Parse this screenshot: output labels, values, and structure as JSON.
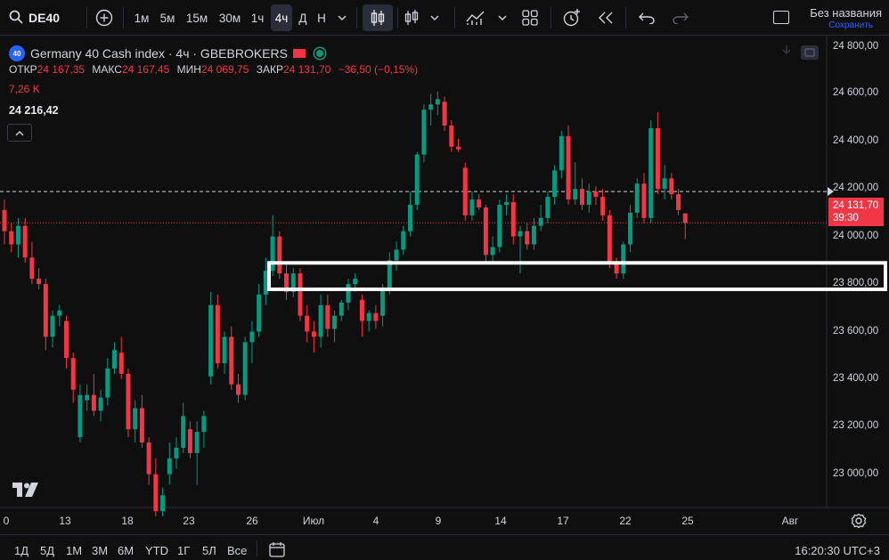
{
  "toolbar": {
    "symbol": "DE40",
    "timeframes": [
      "1м",
      "5м",
      "15м",
      "30м",
      "1ч",
      "4ч",
      "Д",
      "Н"
    ],
    "active_timeframe": "4ч",
    "icons": [
      "search-icon",
      "add-symbol-icon",
      "timeframe-dropdown-icon",
      "candles-icon",
      "indicators-icon",
      "chart-type-dropdown-icon",
      "compare-icon",
      "templates-icon",
      "alert-icon",
      "replay-icon",
      "undo-icon",
      "redo-icon",
      "layout-icon"
    ],
    "layout_name": "Без названия",
    "layout_status": "Сохранить"
  },
  "legend": {
    "badge": "40",
    "title": "Germany 40 Cash index · 4ч · GBEBROKERS",
    "open_label": "ОТКР",
    "open": "24 167,35",
    "high_label": "МАКС",
    "high": "24 167,45",
    "low_label": "МИН",
    "low": "24 069,75",
    "close_label": "ЗАКР",
    "close": "24 131,70",
    "change": "−36,50 (−0,15%)",
    "volume": "7,26 K",
    "crosshair_price": "24 216,42"
  },
  "price_axis": {
    "labels": [
      "24 800,00",
      "24 600,00",
      "24 400,00",
      "24 200,00",
      "24 000,00",
      "23 800,00",
      "23 600,00",
      "23 400,00",
      "23 200,00",
      "23 000,00"
    ],
    "last_price": "24 131,70",
    "countdown": "39:30"
  },
  "time_axis": {
    "labels": [
      "0",
      "13",
      "18",
      "23",
      "26",
      "Июл",
      "4",
      "9",
      "14",
      "17",
      "22",
      "25",
      "Авг"
    ]
  },
  "bottom": {
    "ranges": [
      "1Д",
      "5Д",
      "1М",
      "3М",
      "6М",
      "YTD",
      "1Г",
      "5Л",
      "Все"
    ],
    "clock": "16:20:30 UTC+3"
  },
  "colors": {
    "up": "#089981",
    "down": "#f23645",
    "background": "#0f0f0f",
    "highlight_box": "#ffffff"
  },
  "chart_data": {
    "type": "candlestick",
    "title": "Germany 40 Cash index · 4ч · GBEBROKERS",
    "ylim": [
      22950,
      24850
    ],
    "candles": [
      {
        "o": 24180,
        "h": 24220,
        "l": 24050,
        "c": 24100
      },
      {
        "o": 24100,
        "h": 24130,
        "l": 24020,
        "c": 24050
      },
      {
        "o": 24050,
        "h": 24150,
        "l": 24000,
        "c": 24120
      },
      {
        "o": 24120,
        "h": 24150,
        "l": 23980,
        "c": 24000
      },
      {
        "o": 24000,
        "h": 24060,
        "l": 23900,
        "c": 23920
      },
      {
        "o": 23920,
        "h": 23960,
        "l": 23880,
        "c": 23900
      },
      {
        "o": 23900,
        "h": 23920,
        "l": 23650,
        "c": 23700
      },
      {
        "o": 23700,
        "h": 23800,
        "l": 23660,
        "c": 23780
      },
      {
        "o": 23780,
        "h": 23820,
        "l": 23740,
        "c": 23800
      },
      {
        "o": 23760,
        "h": 23780,
        "l": 23580,
        "c": 23620
      },
      {
        "o": 23620,
        "h": 23640,
        "l": 23450,
        "c": 23500
      },
      {
        "o": 23320,
        "h": 23520,
        "l": 23300,
        "c": 23480
      },
      {
        "o": 23460,
        "h": 23520,
        "l": 23420,
        "c": 23480
      },
      {
        "o": 23480,
        "h": 23560,
        "l": 23400,
        "c": 23420
      },
      {
        "o": 23420,
        "h": 23500,
        "l": 23380,
        "c": 23470
      },
      {
        "o": 23470,
        "h": 23620,
        "l": 23440,
        "c": 23580
      },
      {
        "o": 23580,
        "h": 23680,
        "l": 23560,
        "c": 23650
      },
      {
        "o": 23640,
        "h": 23700,
        "l": 23540,
        "c": 23560
      },
      {
        "o": 23560,
        "h": 23580,
        "l": 23320,
        "c": 23350
      },
      {
        "o": 23350,
        "h": 23460,
        "l": 23300,
        "c": 23430
      },
      {
        "o": 23430,
        "h": 23480,
        "l": 23280,
        "c": 23300
      },
      {
        "o": 23300,
        "h": 23320,
        "l": 23140,
        "c": 23180
      },
      {
        "o": 23180,
        "h": 23240,
        "l": 23020,
        "c": 23040
      },
      {
        "o": 23040,
        "h": 23130,
        "l": 23020,
        "c": 23100
      },
      {
        "o": 23180,
        "h": 23300,
        "l": 23140,
        "c": 23240
      },
      {
        "o": 23240,
        "h": 23320,
        "l": 23200,
        "c": 23280
      },
      {
        "o": 23280,
        "h": 23450,
        "l": 23260,
        "c": 23400
      },
      {
        "o": 23350,
        "h": 23380,
        "l": 23240,
        "c": 23260
      },
      {
        "o": 23260,
        "h": 23380,
        "l": 23140,
        "c": 23340
      },
      {
        "o": 23340,
        "h": 23420,
        "l": 23280,
        "c": 23400
      },
      {
        "o": 23550,
        "h": 23870,
        "l": 23520,
        "c": 23820
      },
      {
        "o": 23820,
        "h": 23860,
        "l": 23580,
        "c": 23600
      },
      {
        "o": 23600,
        "h": 23720,
        "l": 23560,
        "c": 23700
      },
      {
        "o": 23700,
        "h": 23740,
        "l": 23500,
        "c": 23520
      },
      {
        "o": 23520,
        "h": 23560,
        "l": 23450,
        "c": 23480
      },
      {
        "o": 23480,
        "h": 23700,
        "l": 23460,
        "c": 23680
      },
      {
        "o": 23680,
        "h": 23760,
        "l": 23600,
        "c": 23720
      },
      {
        "o": 23720,
        "h": 23900,
        "l": 23700,
        "c": 23860
      },
      {
        "o": 23860,
        "h": 24000,
        "l": 23820,
        "c": 23950
      },
      {
        "o": 23950,
        "h": 24160,
        "l": 23930,
        "c": 24080
      },
      {
        "o": 24080,
        "h": 24100,
        "l": 23920,
        "c": 23940
      },
      {
        "o": 23940,
        "h": 23980,
        "l": 23840,
        "c": 23870
      },
      {
        "o": 23870,
        "h": 23960,
        "l": 23850,
        "c": 23940
      },
      {
        "o": 23940,
        "h": 23960,
        "l": 23760,
        "c": 23780
      },
      {
        "o": 23780,
        "h": 23820,
        "l": 23680,
        "c": 23720
      },
      {
        "o": 23720,
        "h": 23760,
        "l": 23640,
        "c": 23700
      },
      {
        "o": 23700,
        "h": 23860,
        "l": 23660,
        "c": 23820
      },
      {
        "o": 23820,
        "h": 23860,
        "l": 23700,
        "c": 23730
      },
      {
        "o": 23730,
        "h": 23800,
        "l": 23680,
        "c": 23780
      },
      {
        "o": 23780,
        "h": 23840,
        "l": 23760,
        "c": 23830
      },
      {
        "o": 23830,
        "h": 23920,
        "l": 23800,
        "c": 23900
      },
      {
        "o": 23900,
        "h": 23940,
        "l": 23870,
        "c": 23920
      },
      {
        "o": 23840,
        "h": 23860,
        "l": 23700,
        "c": 23760
      },
      {
        "o": 23760,
        "h": 23800,
        "l": 23720,
        "c": 23790
      },
      {
        "o": 23790,
        "h": 23820,
        "l": 23730,
        "c": 23760
      },
      {
        "o": 23780,
        "h": 23900,
        "l": 23740,
        "c": 23880
      },
      {
        "o": 23880,
        "h": 24020,
        "l": 23860,
        "c": 23990
      },
      {
        "o": 23990,
        "h": 24060,
        "l": 23950,
        "c": 24030
      },
      {
        "o": 24030,
        "h": 24120,
        "l": 24010,
        "c": 24100
      },
      {
        "o": 24100,
        "h": 24250,
        "l": 24080,
        "c": 24200
      },
      {
        "o": 24200,
        "h": 24400,
        "l": 24180,
        "c": 24390
      },
      {
        "o": 24390,
        "h": 24580,
        "l": 24360,
        "c": 24560
      },
      {
        "o": 24560,
        "h": 24620,
        "l": 24500,
        "c": 24580
      },
      {
        "o": 24580,
        "h": 24630,
        "l": 24540,
        "c": 24600
      },
      {
        "o": 24590,
        "h": 24610,
        "l": 24480,
        "c": 24500
      },
      {
        "o": 24500,
        "h": 24520,
        "l": 24400,
        "c": 24420
      },
      {
        "o": 24420,
        "h": 24450,
        "l": 24400,
        "c": 24410
      },
      {
        "o": 24340,
        "h": 24360,
        "l": 24140,
        "c": 24160
      },
      {
        "o": 24160,
        "h": 24250,
        "l": 24140,
        "c": 24220
      },
      {
        "o": 24220,
        "h": 24240,
        "l": 24180,
        "c": 24190
      },
      {
        "o": 24190,
        "h": 24200,
        "l": 23980,
        "c": 24010
      },
      {
        "o": 24010,
        "h": 24080,
        "l": 23980,
        "c": 24040
      },
      {
        "o": 24040,
        "h": 24220,
        "l": 24020,
        "c": 24200
      },
      {
        "o": 24200,
        "h": 24240,
        "l": 24160,
        "c": 24210
      },
      {
        "o": 24210,
        "h": 24240,
        "l": 24050,
        "c": 24080
      },
      {
        "o": 24080,
        "h": 24120,
        "l": 23940,
        "c": 24100
      },
      {
        "o": 24100,
        "h": 24130,
        "l": 24030,
        "c": 24050
      },
      {
        "o": 24050,
        "h": 24150,
        "l": 24030,
        "c": 24120
      },
      {
        "o": 24120,
        "h": 24200,
        "l": 24100,
        "c": 24150
      },
      {
        "o": 24150,
        "h": 24250,
        "l": 24130,
        "c": 24230
      },
      {
        "o": 24230,
        "h": 24350,
        "l": 24200,
        "c": 24330
      },
      {
        "o": 24330,
        "h": 24480,
        "l": 24300,
        "c": 24460
      },
      {
        "o": 24460,
        "h": 24500,
        "l": 24200,
        "c": 24220
      },
      {
        "o": 24220,
        "h": 24360,
        "l": 24200,
        "c": 24260
      },
      {
        "o": 24260,
        "h": 24300,
        "l": 24180,
        "c": 24200
      },
      {
        "o": 24200,
        "h": 24280,
        "l": 24170,
        "c": 24250
      },
      {
        "o": 24250,
        "h": 24270,
        "l": 24200,
        "c": 24230
      },
      {
        "o": 24230,
        "h": 24260,
        "l": 24140,
        "c": 24160
      },
      {
        "o": 24160,
        "h": 24180,
        "l": 23960,
        "c": 23980
      },
      {
        "o": 23980,
        "h": 24000,
        "l": 23920,
        "c": 23940
      },
      {
        "o": 23940,
        "h": 24060,
        "l": 23920,
        "c": 24050
      },
      {
        "o": 24050,
        "h": 24200,
        "l": 24020,
        "c": 24170
      },
      {
        "o": 24170,
        "h": 24300,
        "l": 24150,
        "c": 24280
      },
      {
        "o": 24280,
        "h": 24320,
        "l": 24130,
        "c": 24150
      },
      {
        "o": 24150,
        "h": 24520,
        "l": 24130,
        "c": 24490
      },
      {
        "o": 24490,
        "h": 24550,
        "l": 24240,
        "c": 24260
      },
      {
        "o": 24260,
        "h": 24350,
        "l": 24220,
        "c": 24300
      },
      {
        "o": 24300,
        "h": 24320,
        "l": 24220,
        "c": 24240
      },
      {
        "o": 24240,
        "h": 24260,
        "l": 24160,
        "c": 24180
      },
      {
        "o": 24167.35,
        "h": 24167.45,
        "l": 24069.75,
        "c": 24131.7
      }
    ],
    "reference_line": 24250,
    "last_price": 24131.7,
    "highlight_zone": [
      23880,
      23980
    ]
  }
}
